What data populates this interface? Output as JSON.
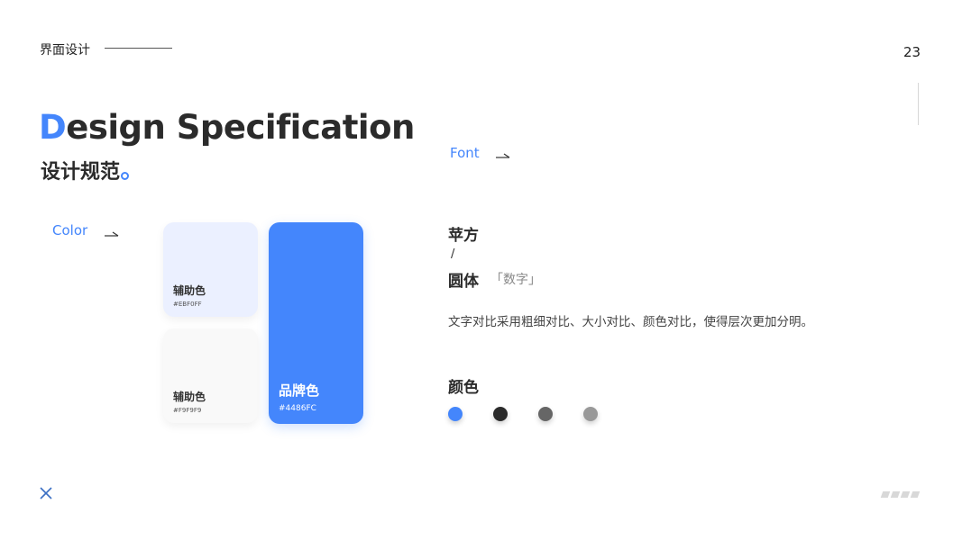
{
  "header": {
    "section_label": "界面设计",
    "page_number": "23"
  },
  "title": {
    "first_letter": "D",
    "rest": "esign Specification",
    "subtitle": "设计规范"
  },
  "color_section": {
    "label": "Color",
    "arrow_icon": "arrow-right-icon",
    "cards": [
      {
        "name": "辅助色",
        "hex": "#EBF0FF",
        "color": "#EBF0FF"
      },
      {
        "name": "辅助色",
        "hex": "#F9F9F9",
        "color": "#F9F9F9"
      },
      {
        "name": "品牌色",
        "hex": "#4486FC",
        "color": "#4486FC"
      }
    ]
  },
  "font_section": {
    "label": "Font",
    "arrow_icon": "arrow-right-icon",
    "font_1": "苹方",
    "separator": "/",
    "font_2": "圆体",
    "font_2_note": "「数字」",
    "description": "文字对比采用粗细对比、大小对比、颜色对比，使得层次更加分明。"
  },
  "palette": {
    "title": "颜色",
    "colors": [
      "#4486FC",
      "#2b2b2b",
      "#666666",
      "#999999"
    ]
  },
  "footer": {
    "close_icon": "close-icon",
    "pagination_icon": "pagination-dots-icon"
  }
}
